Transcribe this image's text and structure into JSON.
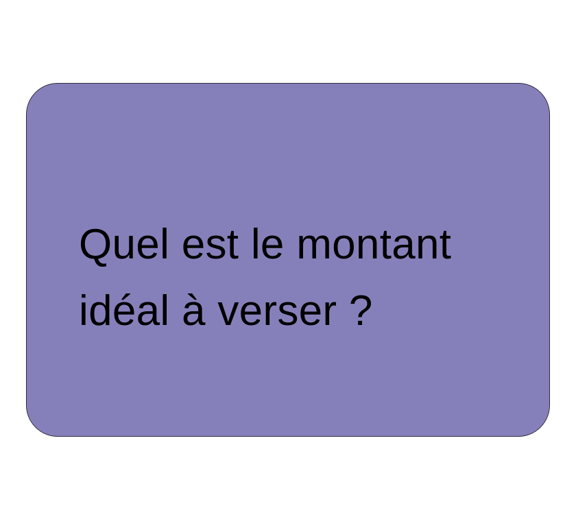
{
  "card": {
    "background_color": "#8680BA",
    "border_color": "#2a2a40",
    "question_lines": [
      "Quel est le montant",
      "idéal à verser ?"
    ]
  }
}
